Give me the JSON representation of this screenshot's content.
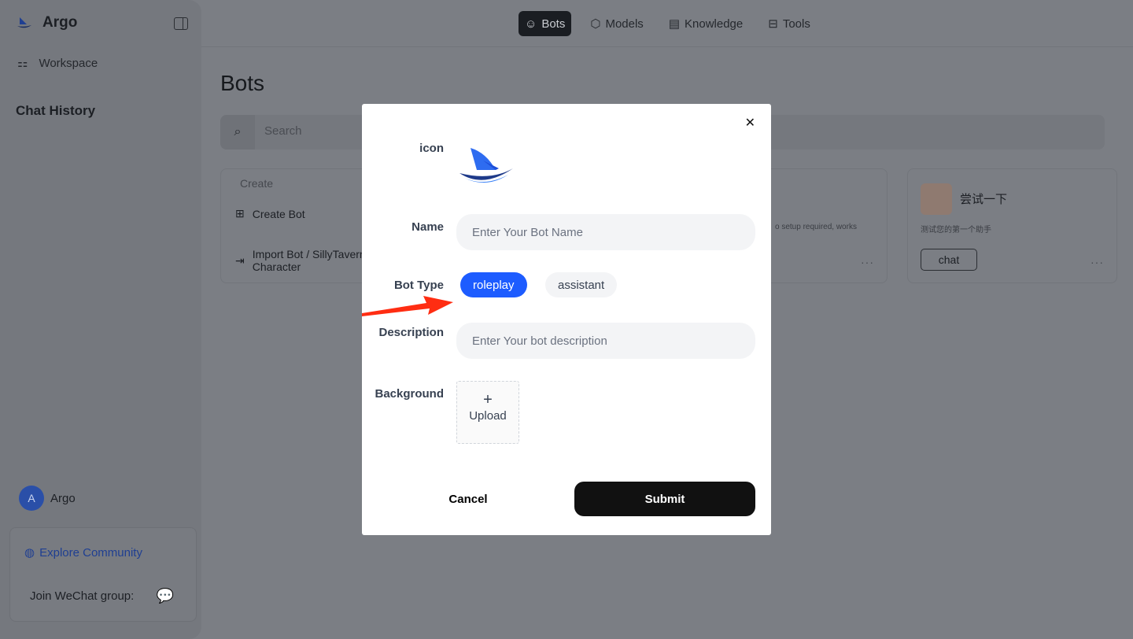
{
  "sidebar": {
    "brand": "Argo",
    "workspace": "Workspace",
    "chat_history": "Chat History",
    "user_initial": "A",
    "user_name": "Argo",
    "explore": "Explore Community",
    "wechat": "Join WeChat group:"
  },
  "topnav": [
    {
      "label": "Bots",
      "icon": "robot-icon",
      "active": true
    },
    {
      "label": "Models",
      "icon": "cube-icon"
    },
    {
      "label": "Knowledge",
      "icon": "book-icon"
    },
    {
      "label": "Tools",
      "icon": "toolbox-icon"
    }
  ],
  "main": {
    "title": "Bots",
    "search_placeholder": "Search",
    "create_header": "Create",
    "create_bot": "Create Bot",
    "import_bot": "Import Bot / SillyTavern",
    "import_bot2": "Character",
    "cards": [
      {
        "desc": "o setup required, works"
      },
      {
        "name": "尝试一下",
        "desc": "测试您的第一个助手",
        "button": "chat"
      }
    ]
  },
  "modal": {
    "icon_label": "icon",
    "name_label": "Name",
    "name_placeholder": "Enter Your Bot Name",
    "type_label": "Bot Type",
    "types": [
      "roleplay",
      "assistant"
    ],
    "selected_type": "roleplay",
    "desc_label": "Description",
    "desc_placeholder": "Enter Your bot description",
    "bg_label": "Background",
    "upload": "Upload",
    "cancel": "Cancel",
    "submit": "Submit"
  },
  "colors": {
    "accent": "#1d5cff",
    "arrow": "#ff2d12"
  }
}
